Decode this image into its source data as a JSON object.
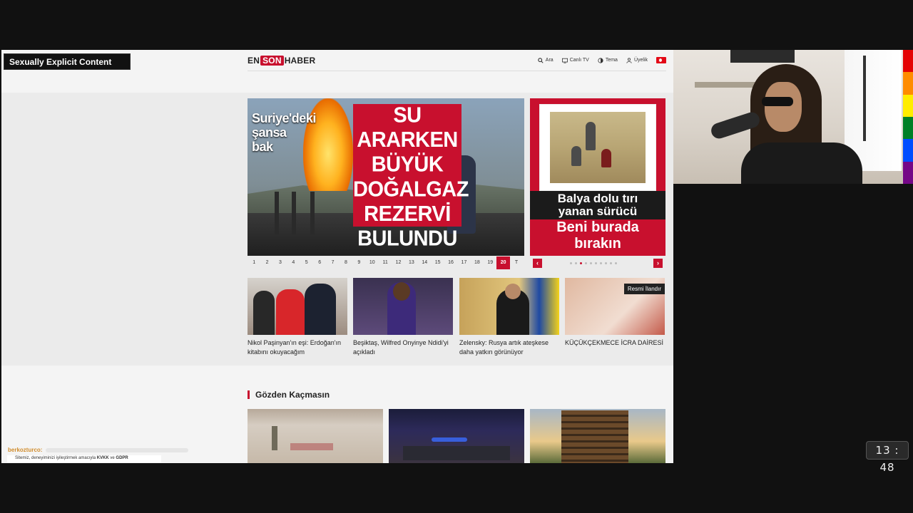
{
  "overlay": {
    "content_warning": "Sexually Explicit Content",
    "clock": "13 : 48",
    "chat_username": "berkozturco:",
    "rainbow_colors": [
      "#e40303",
      "#ff8c00",
      "#ffed00",
      "#008026",
      "#004dff",
      "#750787"
    ]
  },
  "site": {
    "logo_en": "EN",
    "logo_son": "SON",
    "logo_haber": "HABER",
    "nav": [
      {
        "label": "Ara",
        "icon": "search-icon"
      },
      {
        "label": "Canlı TV",
        "icon": "tv-icon"
      },
      {
        "label": "Tema",
        "icon": "theme-icon"
      },
      {
        "label": "Üyelik",
        "icon": "user-icon"
      }
    ],
    "accent": "#c8102e"
  },
  "hero": {
    "kicker": "Suriye'deki şansa bak",
    "headline": "SU ARARKEN BÜYÜK DOĞALGAZ REZERVİ BULUNDU",
    "pager": [
      "1",
      "2",
      "3",
      "4",
      "5",
      "6",
      "7",
      "8",
      "9",
      "10",
      "11",
      "12",
      "13",
      "14",
      "15",
      "16",
      "17",
      "18",
      "19",
      "20",
      "T"
    ],
    "active_page": "20"
  },
  "side_hero": {
    "line1": "Balya dolu tırı yanan sürücü",
    "line2": "Beni burada bırakın",
    "dot_count": 10,
    "active_dot": 2
  },
  "cards": [
    {
      "title": "Nikol Paşinyan'ın eşi: Erdoğan'ın kitabını okuyacağım"
    },
    {
      "title": "Beşiktaş, Wilfred Onyinye Ndidi'yi açıkladı"
    },
    {
      "title": "Zelensky: Rusya artık ateşkese daha yatkın görünüyor"
    },
    {
      "title": "KÜÇÜKÇEKMECE İCRA DAİRESİ",
      "badge": "Resmi İlandır"
    }
  ],
  "section": {
    "title": "Gözden Kaçmasın"
  },
  "cookie": {
    "text": "Sitemiz, deneyiminizi iyileştirmek amacıyla",
    "kvkk": "KVKK",
    "ve": "ve",
    "gdpr": "GDPR"
  }
}
